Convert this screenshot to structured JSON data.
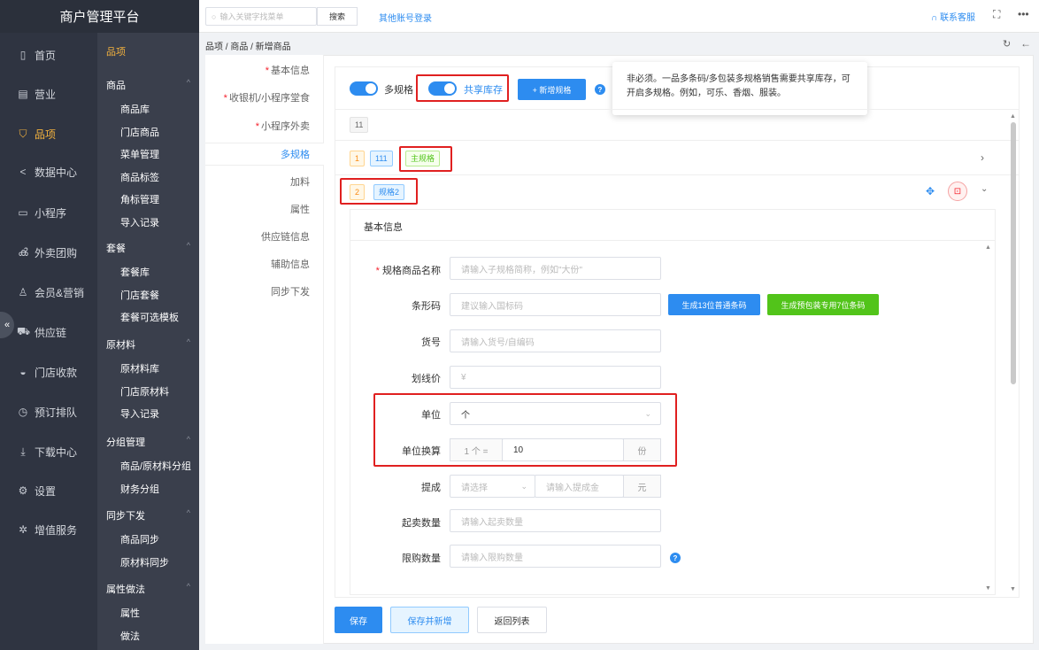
{
  "brand": "商户管理平台",
  "nav_primary": [
    {
      "label": "首页",
      "icon": "tablet-icon"
    },
    {
      "label": "营业",
      "icon": "calendar-icon"
    },
    {
      "label": "品项",
      "icon": "bag-icon"
    },
    {
      "label": "数据中心",
      "icon": "share-icon"
    },
    {
      "label": "小程序",
      "icon": "phone-icon"
    },
    {
      "label": "外卖团购",
      "icon": "bike-icon"
    },
    {
      "label": "会员&营销",
      "icon": "user-icon"
    },
    {
      "label": "供应链",
      "icon": "truck-icon"
    },
    {
      "label": "门店收款",
      "icon": "wallet-icon"
    },
    {
      "label": "预订排队",
      "icon": "clock-icon"
    },
    {
      "label": "下载中心",
      "icon": "download-icon"
    },
    {
      "label": "设置",
      "icon": "gear-icon"
    },
    {
      "label": "增值服务",
      "icon": "gift-icon"
    }
  ],
  "nav_secondary": {
    "top": "品项",
    "groups": [
      {
        "label": "商品",
        "items": [
          "商品库",
          "门店商品",
          "菜单管理",
          "商品标签",
          "角标管理",
          "导入记录"
        ]
      },
      {
        "label": "套餐",
        "items": [
          "套餐库",
          "门店套餐",
          "套餐可选模板"
        ]
      },
      {
        "label": "原材料",
        "items": [
          "原材料库",
          "门店原材料",
          "导入记录"
        ]
      },
      {
        "label": "分组管理",
        "items": [
          "商品/原材料分组",
          "财务分组"
        ]
      },
      {
        "label": "同步下发",
        "items": [
          "商品同步",
          "原材料同步"
        ]
      },
      {
        "label": "属性做法",
        "items": [
          "属性",
          "做法"
        ]
      }
    ]
  },
  "topbar": {
    "search_placeholder": "输入关键字找菜单",
    "search_btn": "搜索",
    "other_login": "其他账号登录",
    "contact": "联系客服"
  },
  "breadcrumb": "品项 / 商品 / 新增商品",
  "section_nav": [
    {
      "label": "基本信息",
      "required": true
    },
    {
      "label": "收银机/小程序堂食",
      "required": true
    },
    {
      "label": "小程序外卖",
      "required": true
    },
    {
      "label": "多规格",
      "required": false
    },
    {
      "label": "加料",
      "required": false
    },
    {
      "label": "属性",
      "required": false
    },
    {
      "label": "供应链信息",
      "required": false
    },
    {
      "label": "辅助信息",
      "required": false
    },
    {
      "label": "同步下发",
      "required": false
    }
  ],
  "spec": {
    "toggle1": "多规格",
    "toggle2": "共享库存",
    "add_btn": "+ 新增规格",
    "tooltip": "非必须。一品多条码/多包装多规格销售需要共享库存，可开启多规格。例如，可乐、香烟、服装。",
    "count_tag": "11",
    "row1": {
      "index": "1",
      "name": "111",
      "badge": "主规格"
    },
    "row2": {
      "index": "2",
      "name": "规格2"
    }
  },
  "form": {
    "section_title": "基本信息",
    "name_label": "规格商品名称",
    "name_placeholder": "请输入子规格简称，例如\"大份\"",
    "barcode_label": "条形码",
    "barcode_placeholder": "建议输入国标码",
    "barcode_btn1": "生成13位普通条码",
    "barcode_btn2": "生成预包装专用7位条码",
    "sku_label": "货号",
    "sku_placeholder": "请输入货号/自编码",
    "price_label": "划线价",
    "price_placeholder": "¥",
    "unit_label": "单位",
    "unit_value": "个",
    "conv_label": "单位换算",
    "conv_prefix": "1 个 =",
    "conv_value": "10",
    "conv_suffix": "份",
    "commission_label": "提成",
    "commission_select": "请选择",
    "commission_placeholder": "请输入提成金",
    "commission_suffix": "元",
    "min_label": "起卖数量",
    "min_placeholder": "请输入起卖数量",
    "limit_label": "限购数量",
    "limit_placeholder": "请输入限购数量"
  },
  "footer": {
    "save": "保存",
    "save_new": "保存并新增",
    "back": "返回列表"
  },
  "colors": {
    "accent": "#2d8cf0",
    "highlight": "#e02020",
    "active_nav": "#f3b23e"
  }
}
